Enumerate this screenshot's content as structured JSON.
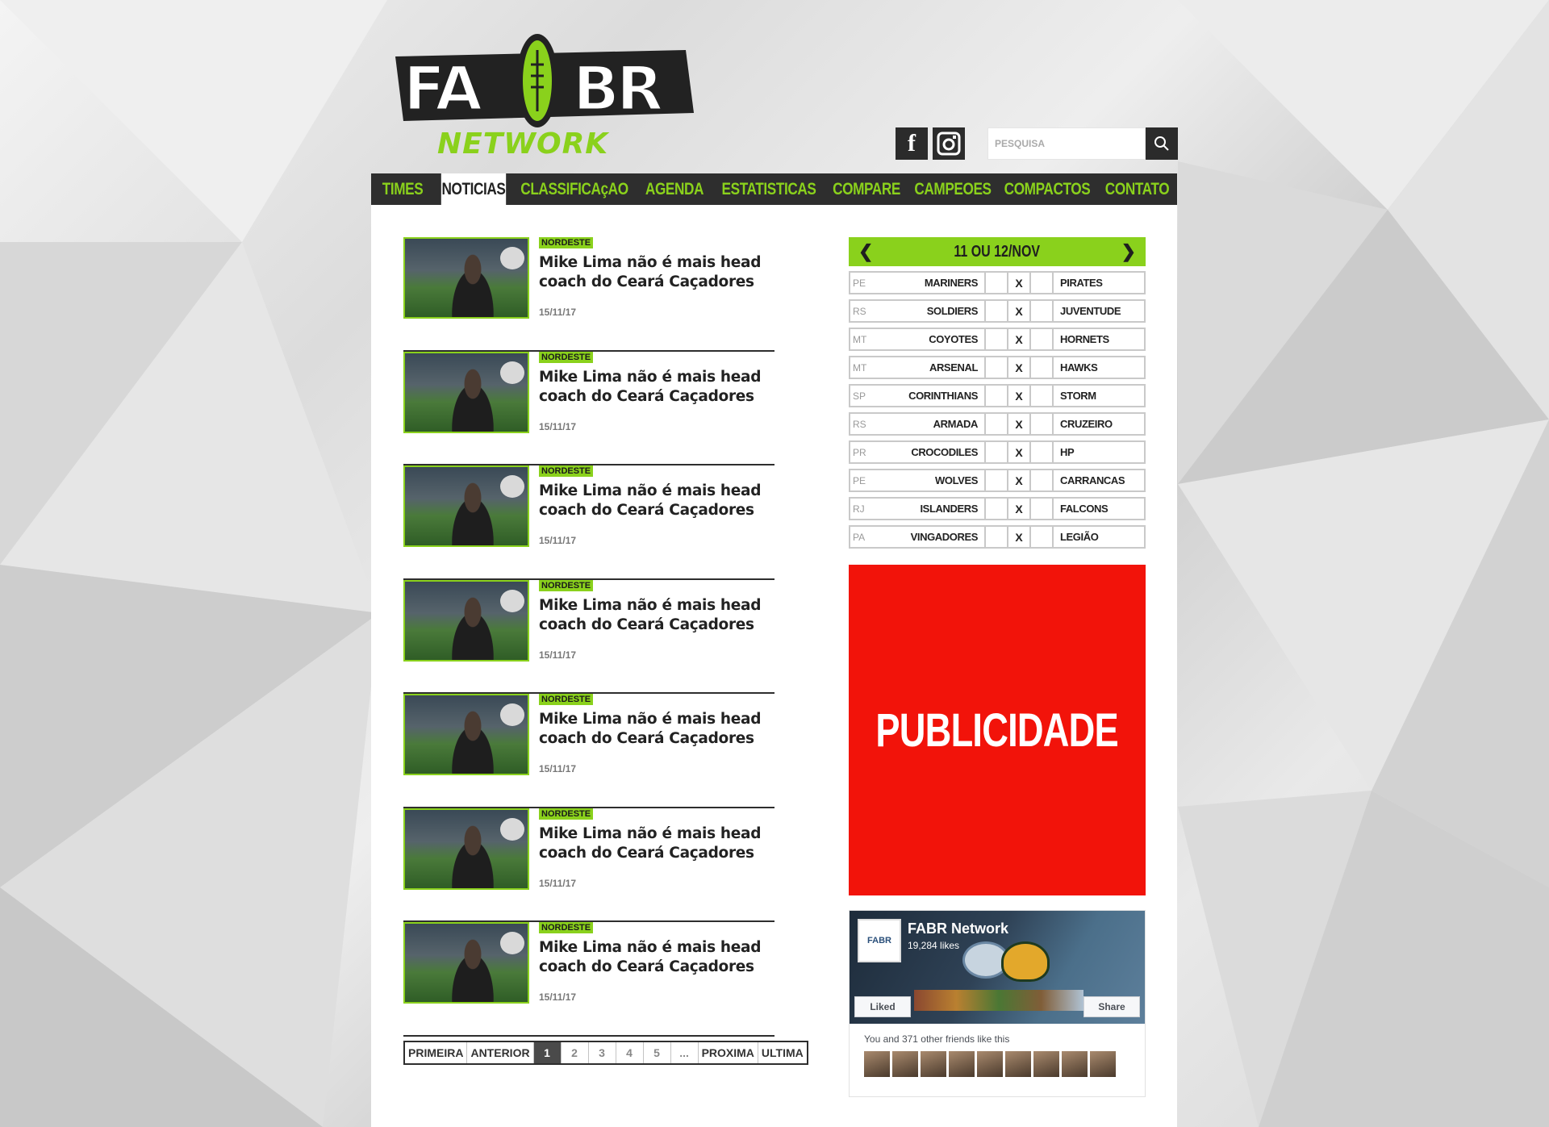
{
  "brand": {
    "logo_top": "FA BR",
    "logo_bottom": "NETWORK"
  },
  "social": {
    "facebook_icon": "facebook-icon",
    "instagram_icon": "instagram-icon"
  },
  "search": {
    "placeholder": "PESQUISA"
  },
  "nav": {
    "items": [
      {
        "label": "TIMES"
      },
      {
        "label": "NOTICIAS"
      },
      {
        "label": "CLASSIFICAçAO"
      },
      {
        "label": "AGENDA"
      },
      {
        "label": "ESTATISTICAS"
      },
      {
        "label": "COMPARE"
      },
      {
        "label": "CAMPEOES"
      },
      {
        "label": "COMPACTOS"
      },
      {
        "label": "CONTATO"
      }
    ],
    "active": "NOTICIAS"
  },
  "news": [
    {
      "tag": "NORDESTE",
      "title": "Mike Lima não é mais head coach do Ceará Caçadores",
      "date": "15/11/17"
    },
    {
      "tag": "NORDESTE",
      "title": "Mike Lima não é mais head coach do Ceará Caçadores",
      "date": "15/11/17"
    },
    {
      "tag": "NORDESTE",
      "title": "Mike Lima não é mais head coach do Ceará Caçadores",
      "date": "15/11/17"
    },
    {
      "tag": "NORDESTE",
      "title": "Mike Lima não é mais head coach do Ceará Caçadores",
      "date": "15/11/17"
    },
    {
      "tag": "NORDESTE",
      "title": "Mike Lima não é mais head coach do Ceará Caçadores",
      "date": "15/11/17"
    },
    {
      "tag": "NORDESTE",
      "title": "Mike Lima não é mais head coach do Ceará Caçadores",
      "date": "15/11/17"
    },
    {
      "tag": "NORDESTE",
      "title": "Mike Lima não é mais head coach do Ceará Caçadores",
      "date": "15/11/17"
    }
  ],
  "pager": {
    "first": "PRIMEIRA",
    "prev": "ANTERIOR",
    "pages": [
      "1",
      "2",
      "3",
      "4",
      "5",
      "..."
    ],
    "next": "PROXIMA",
    "last": "ULTIMA",
    "current": "1"
  },
  "schedule": {
    "date": "11 OU 12/NOV",
    "prev_icon": "chevron-left-icon",
    "next_icon": "chevron-right-icon",
    "games": [
      {
        "uf": "PE",
        "home": "MARINERS",
        "vs": "X",
        "away": "PIRATES"
      },
      {
        "uf": "RS",
        "home": "SOLDIERS",
        "vs": "X",
        "away": "JUVENTUDE"
      },
      {
        "uf": "MT",
        "home": "COYOTES",
        "vs": "X",
        "away": "HORNETS"
      },
      {
        "uf": "MT",
        "home": "ARSENAL",
        "vs": "X",
        "away": "HAWKS"
      },
      {
        "uf": "SP",
        "home": "CORINTHIANS",
        "vs": "X",
        "away": "STORM"
      },
      {
        "uf": "RS",
        "home": "ARMADA",
        "vs": "X",
        "away": "CRUZEIRO"
      },
      {
        "uf": "PR",
        "home": "CROCODILES",
        "vs": "X",
        "away": "HP"
      },
      {
        "uf": "PE",
        "home": "WOLVES",
        "vs": "X",
        "away": "CARRANCAS"
      },
      {
        "uf": "RJ",
        "home": "ISLANDERS",
        "vs": "X",
        "away": "FALCONS"
      },
      {
        "uf": "PA",
        "home": "VINGADORES",
        "vs": "X",
        "away": "LEGIÃO"
      }
    ]
  },
  "ad": {
    "label": "PUBLICIDADE"
  },
  "facebook": {
    "page_name": "FABR Network",
    "likes": "19,284 likes",
    "liked_label": "Liked",
    "share_label": "Share",
    "friends_text": "You and 371 other friends like this"
  },
  "colors": {
    "accent": "#8ad11c",
    "dark": "#2e2e2e",
    "ad": "#f2130a"
  }
}
